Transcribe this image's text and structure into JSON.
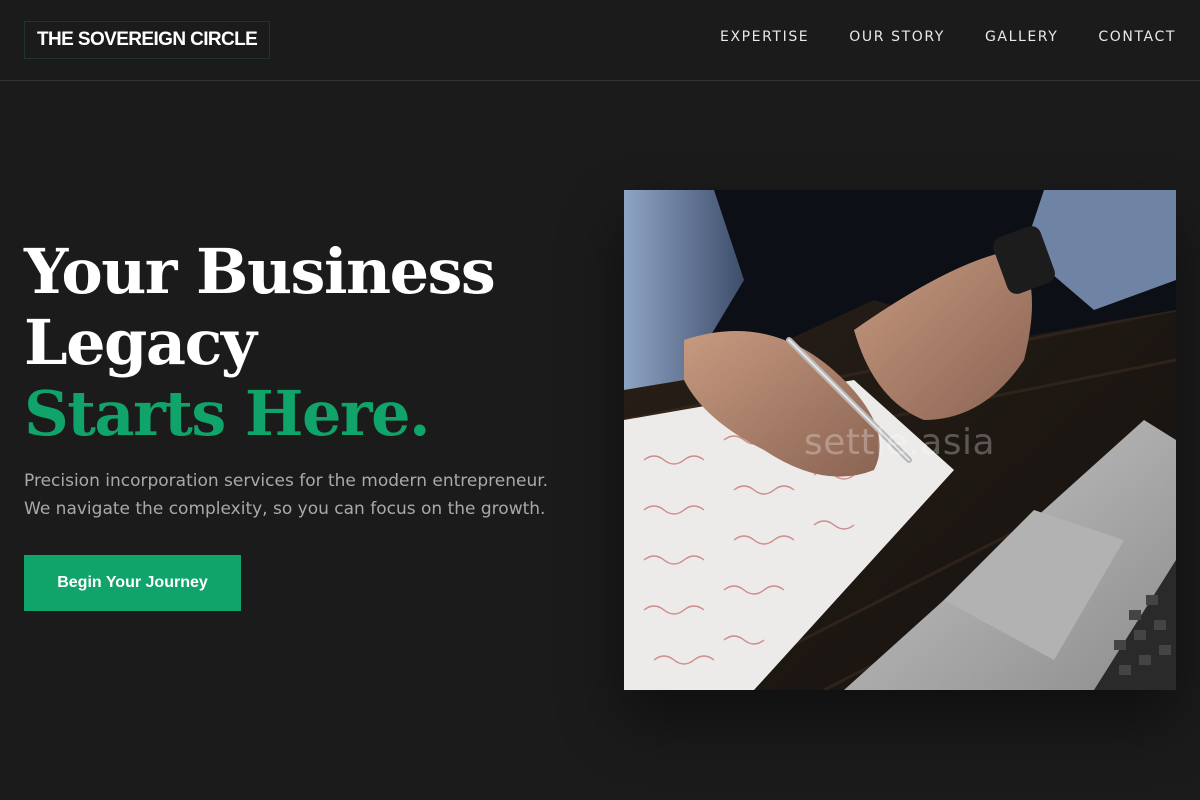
{
  "brand": {
    "logo_text": "THE SOVEREIGN CIRCLE"
  },
  "nav": {
    "items": [
      {
        "label": "EXPERTISE"
      },
      {
        "label": "OUR STORY"
      },
      {
        "label": "GALLERY"
      },
      {
        "label": "CONTACT"
      }
    ]
  },
  "hero": {
    "headline_line1": "Your Business",
    "headline_line2": "Legacy",
    "headline_accent": "Starts Here.",
    "subtext": "Precision incorporation services for the modern entrepreneur. We navigate the complexity, so you can focus on the growth.",
    "cta_label": "Begin Your Journey",
    "image_watermark": "settle.asia"
  },
  "colors": {
    "background": "#1b1b1b",
    "accent": "#10a36a",
    "text": "#ffffff",
    "muted_text": "#a9a9a9"
  }
}
